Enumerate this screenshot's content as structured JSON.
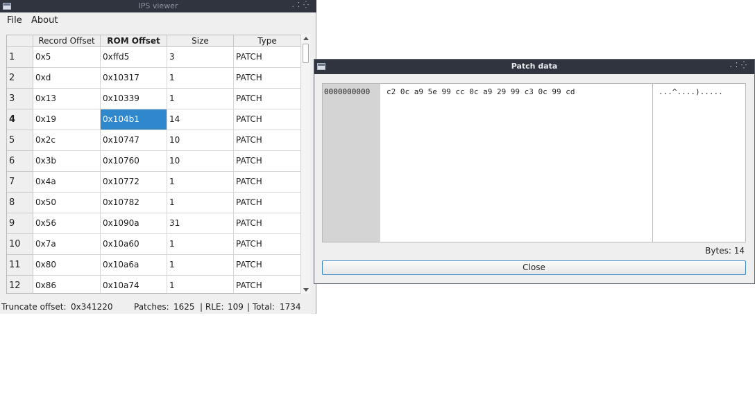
{
  "main_window": {
    "title": "IPS viewer",
    "menu": [
      "File",
      "About"
    ],
    "columns": [
      "Record Offset",
      "ROM Offset",
      "Size",
      "Type"
    ],
    "rows": [
      {
        "num": "1",
        "record_offset": "0x5",
        "rom_offset": "0xffd5",
        "size": "3",
        "type": "PATCH"
      },
      {
        "num": "2",
        "record_offset": "0xd",
        "rom_offset": "0x10317",
        "size": "1",
        "type": "PATCH"
      },
      {
        "num": "3",
        "record_offset": "0x13",
        "rom_offset": "0x10339",
        "size": "1",
        "type": "PATCH"
      },
      {
        "num": "4",
        "record_offset": "0x19",
        "rom_offset": "0x104b1",
        "size": "14",
        "type": "PATCH"
      },
      {
        "num": "5",
        "record_offset": "0x2c",
        "rom_offset": "0x10747",
        "size": "10",
        "type": "PATCH"
      },
      {
        "num": "6",
        "record_offset": "0x3b",
        "rom_offset": "0x10760",
        "size": "10",
        "type": "PATCH"
      },
      {
        "num": "7",
        "record_offset": "0x4a",
        "rom_offset": "0x10772",
        "size": "1",
        "type": "PATCH"
      },
      {
        "num": "8",
        "record_offset": "0x50",
        "rom_offset": "0x10782",
        "size": "1",
        "type": "PATCH"
      },
      {
        "num": "9",
        "record_offset": "0x56",
        "rom_offset": "0x1090a",
        "size": "31",
        "type": "PATCH"
      },
      {
        "num": "10",
        "record_offset": "0x7a",
        "rom_offset": "0x10a60",
        "size": "1",
        "type": "PATCH"
      },
      {
        "num": "11",
        "record_offset": "0x80",
        "rom_offset": "0x10a6a",
        "size": "1",
        "type": "PATCH"
      },
      {
        "num": "12",
        "record_offset": "0x86",
        "rom_offset": "0x10a74",
        "size": "1",
        "type": "PATCH"
      }
    ],
    "selected_row": 3,
    "selected_col": 1,
    "status": {
      "truncate_label": "Truncate offset:",
      "truncate_value": "0x341220",
      "patches_label": "Patches:",
      "patches_value": "1625",
      "rle_label": "| RLE:",
      "rle_value": "109",
      "total_label": "| Total:",
      "total_value": "1734"
    }
  },
  "dialog": {
    "title": "Patch data",
    "address": "0000000000",
    "hex": "c2 0c a9 5e 99 cc 0c a9 29 99 c3 0c 99 cd",
    "ascii": "...^....).....",
    "bytes_label": "Bytes:",
    "bytes_value": "14",
    "close_label": "Close"
  },
  "colors": {
    "titlebar": "#2f343f",
    "selection": "#2f87cc",
    "window_bg": "#efefef",
    "close_border": "#3d87c4"
  }
}
